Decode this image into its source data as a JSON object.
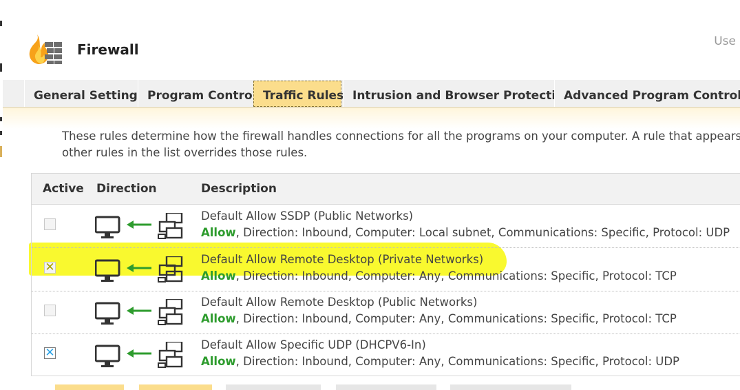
{
  "app": {
    "title": "Firewall",
    "user_link": "Use"
  },
  "tabs": [
    {
      "label": "General Settings",
      "active": false
    },
    {
      "label": "Program Control",
      "active": false
    },
    {
      "label": "Traffic Rules",
      "active": true
    },
    {
      "label": "Intrusion and Browser Protection",
      "active": false
    },
    {
      "label": "Advanced Program Control",
      "active": false
    }
  ],
  "intro": {
    "line1": "These rules determine how the firewall handles connections for all the programs on your computer. A rule that appears abov",
    "line2": "other rules in the list overrides those rules."
  },
  "table": {
    "headers": {
      "active": "Active",
      "direction": "Direction",
      "description": "Description"
    },
    "rows": [
      {
        "active": false,
        "name": "Default Allow SSDP (Public Networks)",
        "action": "Allow",
        "detail": ", Direction: Inbound, Computer: Local subnet, Communications: Specific, Protocol: UDP",
        "direction_icon": "computer-inbound-network-icon"
      },
      {
        "active": "disabled-checked",
        "name": "Default Allow Remote Desktop (Private Networks)",
        "action": "Allow",
        "detail": ", Direction: Inbound, Computer: Any, Communications: Specific, Protocol: TCP",
        "direction_icon": "computer-inbound-network-icon",
        "highlighted": true
      },
      {
        "active": false,
        "name": "Default Allow Remote Desktop (Public Networks)",
        "action": "Allow",
        "detail": ", Direction: Inbound, Computer: Any, Communications: Specific, Protocol: TCP",
        "direction_icon": "computer-inbound-network-icon"
      },
      {
        "active": true,
        "name": "Default Allow Specific UDP (DHCPV6-In)",
        "action": "Allow",
        "detail": ", Direction: Inbound, Computer: Any, Communications: Specific, Protocol: UDP",
        "direction_icon": "computer-inbound-network-icon"
      }
    ]
  },
  "colors": {
    "accent": "#fbdd8c",
    "allow_green": "#2e9c2e",
    "highlight": "#f8f80a",
    "check_blue": "#2aa3e8"
  },
  "icons": {
    "logo": "firewall-flame-wall-icon"
  }
}
